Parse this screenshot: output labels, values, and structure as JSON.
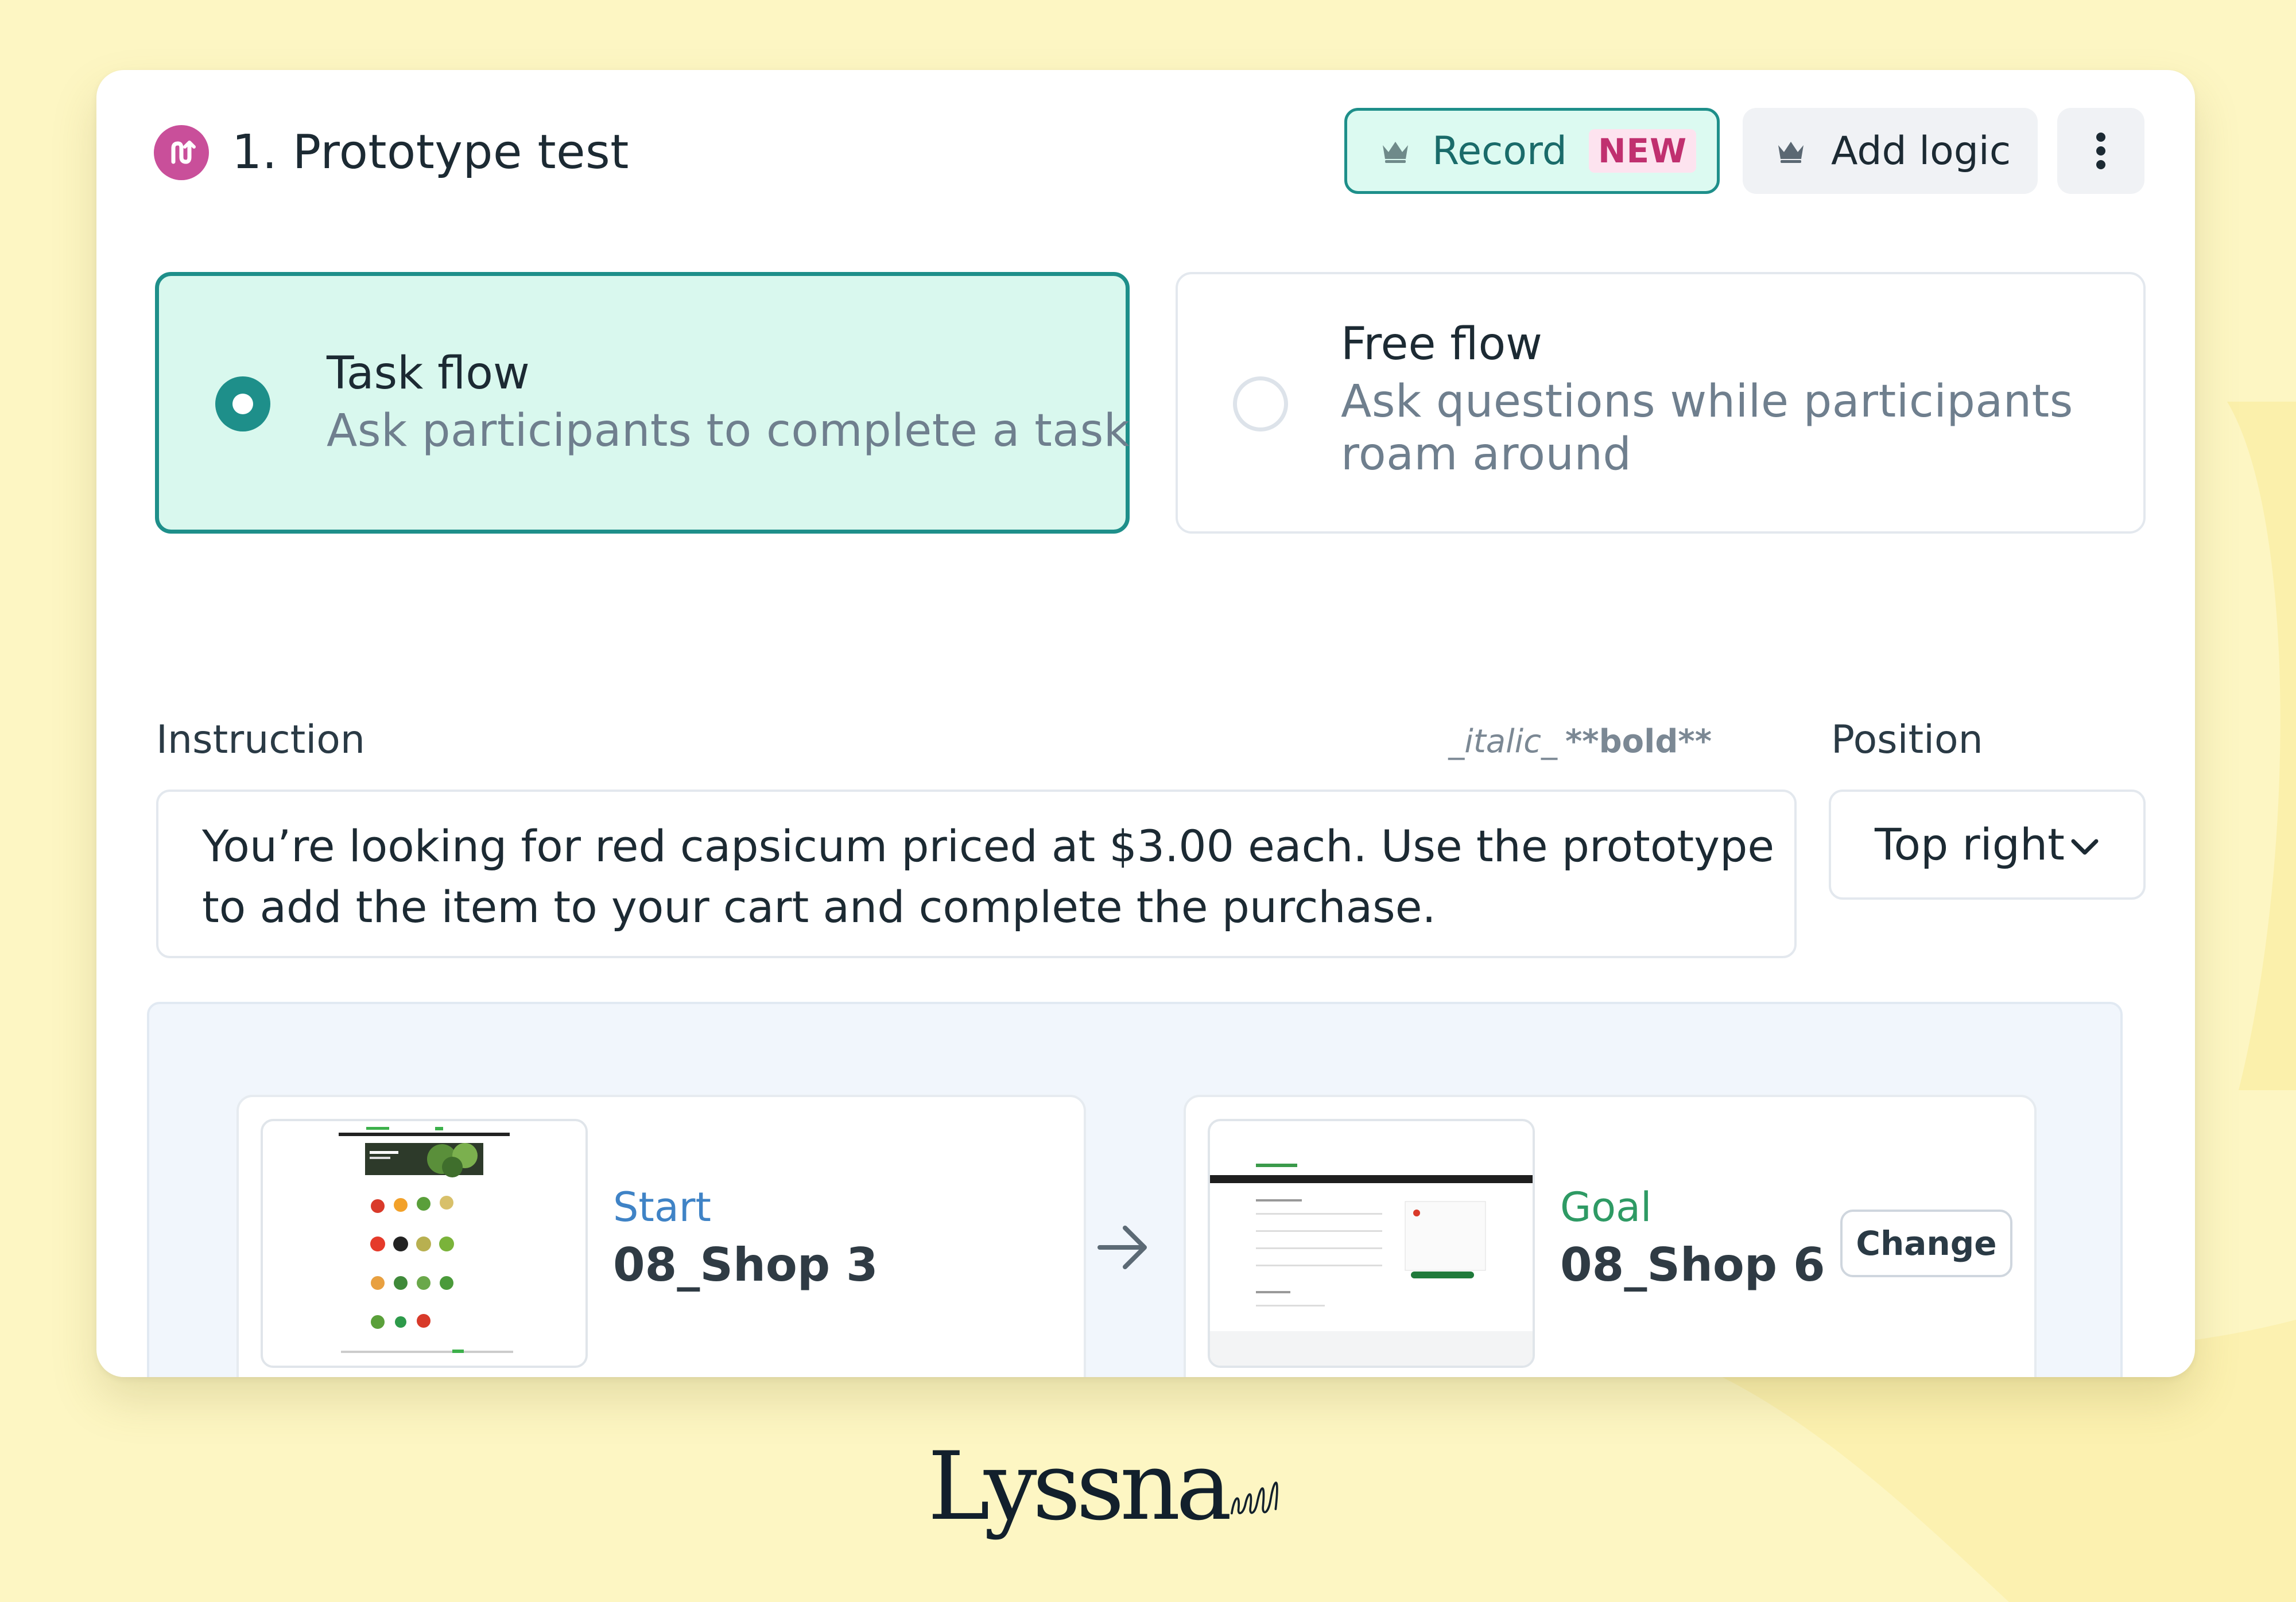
{
  "colors": {
    "page_bg": "#fdf6c3",
    "accent_teal": "#1e8f8a",
    "selected_bg": "#d9f8ee",
    "badge_new_bg": "#fde3ef",
    "badge_new_text": "#c0306f",
    "title_icon": "#c94f9a",
    "start_label": "#3f83c6",
    "goal_label": "#2e9a64"
  },
  "header": {
    "title": "1. Prototype test",
    "title_icon": "prototype-test-icon",
    "record_label": "Record",
    "record_badge": "NEW",
    "record_icon": "crown-icon",
    "add_logic_label": "Add logic",
    "add_logic_icon": "crown-icon",
    "more_icon": "kebab-menu-icon"
  },
  "flow_type": {
    "selected": "task",
    "task": {
      "title": "Task flow",
      "description": "Ask participants to complete a task"
    },
    "free": {
      "title": "Free flow",
      "description": "Ask questions while participants roam around"
    }
  },
  "instruction": {
    "label": "Instruction",
    "markdown_hint_italic": "_italic_",
    "markdown_hint_bold": "**bold**",
    "value": "You’re looking for red capsicum priced at $3.00 each. Use the prototype to add the item to your cart and complete the purchase."
  },
  "position": {
    "label": "Position",
    "value": "Top right"
  },
  "flow": {
    "start": {
      "kind": "Start",
      "screen": "08_Shop 3"
    },
    "goal": {
      "kind": "Goal",
      "screen": "08_Shop 6",
      "change_label": "Change"
    }
  },
  "brand": {
    "name": "Lyssna"
  }
}
